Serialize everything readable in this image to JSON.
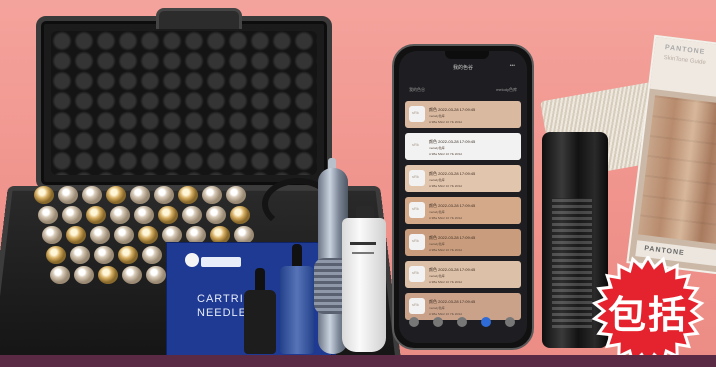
{
  "product_box": {
    "line1": "CARTRIDGE",
    "line2": "NEEDLE"
  },
  "phone": {
    "screen_title": "我的色谷",
    "tab_left": "我的色谷",
    "tab_right": "melody色库",
    "list_items": [
      {
        "swatch": "sRk",
        "line_a": "颜色 2022-03-28 17:09:45",
        "line_b": "melody色库",
        "line_c": "A 9Ba 5Ab2 10 Ylk 2R1d",
        "color": "#d9b9a0"
      },
      {
        "swatch": "sRk",
        "line_a": "颜色 2022-03-28 17:09:45",
        "line_b": "melody色库",
        "line_c": "A 9Ba 5Ab2 10 Ylk 2R1d",
        "color": "#f2f2f2"
      },
      {
        "swatch": "sRk",
        "line_a": "颜色 2022-03-28 17:09:45",
        "line_b": "melody色库",
        "line_c": "A 9Ba 5Ab2 10 Ylk 2R1d",
        "color": "#e2c5ad"
      },
      {
        "swatch": "sRk",
        "line_a": "颜色 2022-03-28 17:09:45",
        "line_b": "melody色库",
        "line_c": "A 9Ba 5Ab2 10 Ylk 2R1d",
        "color": "#d4a98a"
      },
      {
        "swatch": "sRk",
        "line_a": "颜色 2022-03-28 17:09:45",
        "line_b": "melody色库",
        "line_c": "A 9Ba 5Ab2 10 Ylk 2R1d",
        "color": "#c89c7c"
      },
      {
        "swatch": "sRk",
        "line_a": "颜色 2022-03-28 17:09:45",
        "line_b": "melody色库",
        "line_c": "A 9Ba 5Ab2 10 Ylk 2R1d",
        "color": "#dcc0a7"
      },
      {
        "swatch": "sRk",
        "line_a": "颜色 2022-03-28 17:09:45",
        "line_b": "melody色库",
        "line_c": "A 9Ba 5Ab2 10 Ylk 2R1d",
        "color": "#caa28a"
      }
    ]
  },
  "pantone": {
    "brand_top": "PANTONE",
    "subtitle": "SkinTone Guide",
    "brand_bottom": "PANTONE"
  },
  "badge": {
    "label": "包括",
    "color": "#e5232e"
  }
}
